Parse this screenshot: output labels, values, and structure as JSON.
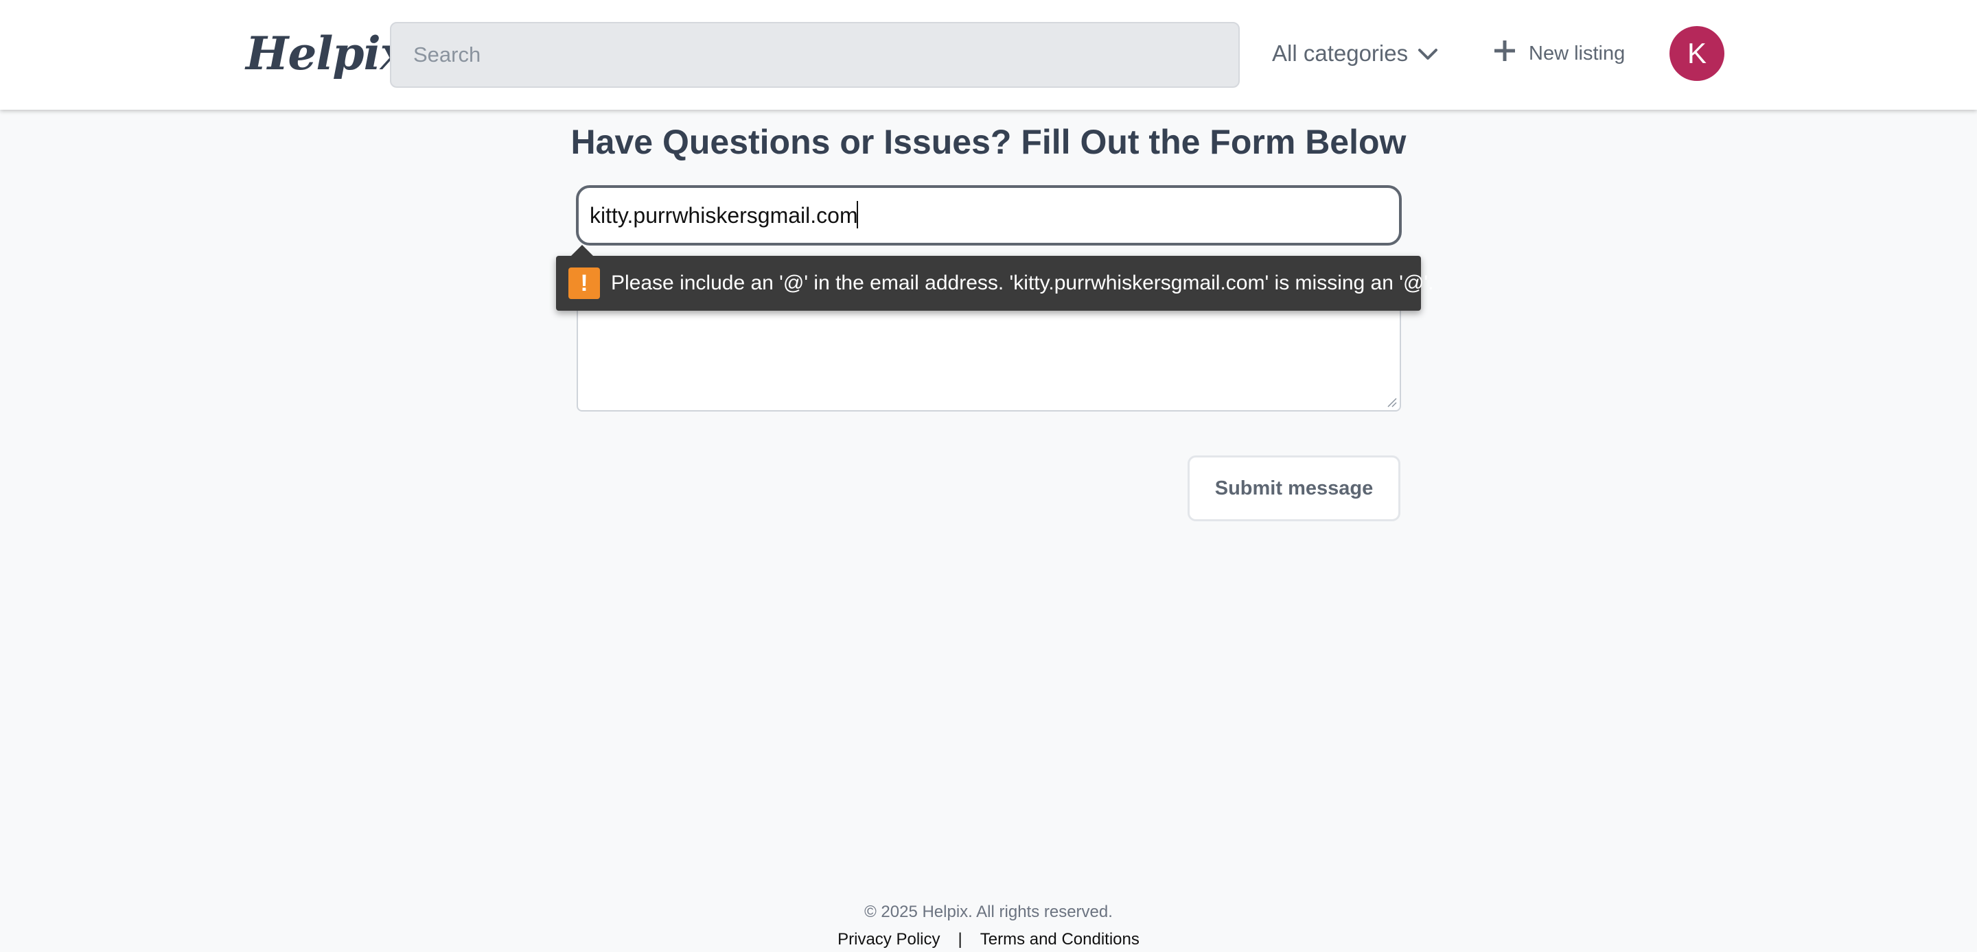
{
  "header": {
    "logo": "Helpix",
    "search_placeholder": "Search",
    "categories_label": "All categories",
    "new_listing_label": "New listing",
    "avatar_initial": "K",
    "avatar_color": "#b5285a"
  },
  "main": {
    "title": "Have Questions or Issues? Fill Out the Form Below",
    "email_value": "kitty.purrwhiskersgmail.com",
    "message_value": "",
    "submit_label": "Submit message"
  },
  "validation": {
    "icon_symbol": "!",
    "message": "Please include an '@' in the email address. 'kitty.purrwhiskersgmail.com' is missing an '@'.",
    "icon_color": "#f28c28"
  },
  "footer": {
    "copyright": "© 2025 Helpix. All rights reserved.",
    "privacy_label": "Privacy Policy",
    "separator": "|",
    "terms_label": "Terms and Conditions"
  },
  "icons": {
    "categories": "chevron-down-icon",
    "new_listing": "plus-icon",
    "validation": "warning-icon"
  }
}
